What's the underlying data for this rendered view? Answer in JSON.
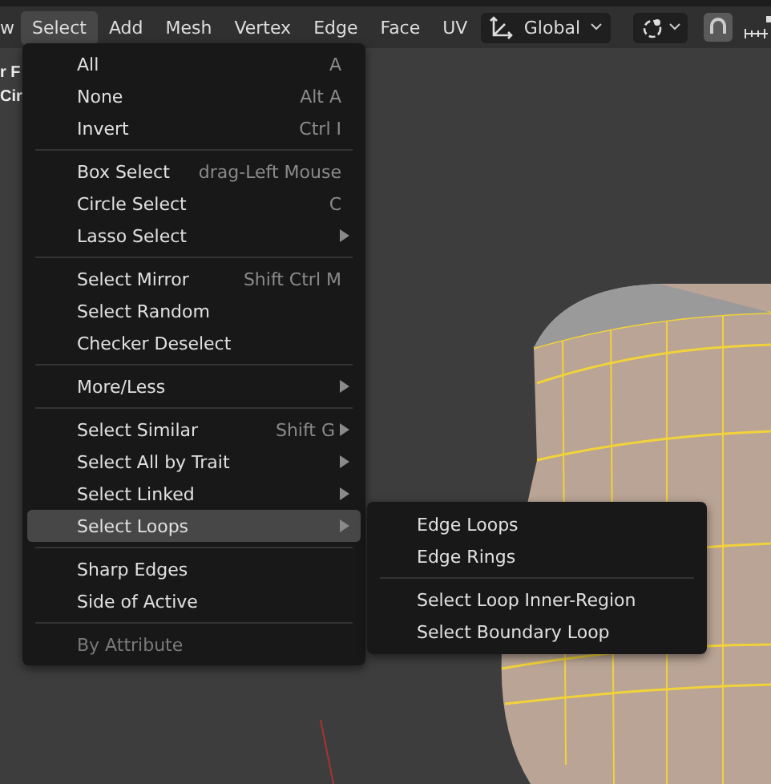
{
  "header": {
    "menus": [
      {
        "label": "w",
        "selected": false
      },
      {
        "label": "Select",
        "selected": true
      },
      {
        "label": "Add",
        "selected": false
      },
      {
        "label": "Mesh",
        "selected": false
      },
      {
        "label": "Vertex",
        "selected": false
      },
      {
        "label": "Edge",
        "selected": false
      },
      {
        "label": "Face",
        "selected": false
      },
      {
        "label": "UV",
        "selected": false
      }
    ],
    "orientation": {
      "label": "Global"
    }
  },
  "side_labels": [
    "r F",
    "Cir"
  ],
  "menu": {
    "items": [
      {
        "kind": "item",
        "label": "All",
        "shortcut": "A",
        "submenu": false,
        "disabled": false,
        "selected": false
      },
      {
        "kind": "item",
        "label": "None",
        "shortcut": "Alt A",
        "submenu": false,
        "disabled": false,
        "selected": false
      },
      {
        "kind": "item",
        "label": "Invert",
        "shortcut": "Ctrl I",
        "submenu": false,
        "disabled": false,
        "selected": false
      },
      {
        "kind": "separator"
      },
      {
        "kind": "item",
        "label": "Box Select",
        "shortcut": "drag-Left Mouse",
        "submenu": false,
        "disabled": false,
        "selected": false
      },
      {
        "kind": "item",
        "label": "Circle Select",
        "shortcut": "C",
        "submenu": false,
        "disabled": false,
        "selected": false
      },
      {
        "kind": "item",
        "label": "Lasso Select",
        "submenu": true,
        "disabled": false,
        "selected": false
      },
      {
        "kind": "separator"
      },
      {
        "kind": "item",
        "label": "Select Mirror",
        "shortcut": "Shift Ctrl M",
        "submenu": false,
        "disabled": false,
        "selected": false
      },
      {
        "kind": "item",
        "label": "Select Random",
        "submenu": false,
        "disabled": false,
        "selected": false
      },
      {
        "kind": "item",
        "label": "Checker Deselect",
        "submenu": false,
        "disabled": false,
        "selected": false
      },
      {
        "kind": "separator"
      },
      {
        "kind": "item",
        "label": "More/Less",
        "submenu": true,
        "disabled": false,
        "selected": false
      },
      {
        "kind": "separator"
      },
      {
        "kind": "item",
        "label": "Select Similar",
        "shortcut": "Shift G",
        "submenu": true,
        "disabled": false,
        "selected": false
      },
      {
        "kind": "item",
        "label": "Select All by Trait",
        "submenu": true,
        "disabled": false,
        "selected": false
      },
      {
        "kind": "item",
        "label": "Select Linked",
        "submenu": true,
        "disabled": false,
        "selected": false
      },
      {
        "kind": "item",
        "label": "Select Loops",
        "submenu": true,
        "disabled": false,
        "selected": true
      },
      {
        "kind": "separator"
      },
      {
        "kind": "item",
        "label": "Sharp Edges",
        "submenu": false,
        "disabled": false,
        "selected": false
      },
      {
        "kind": "item",
        "label": "Side of Active",
        "submenu": false,
        "disabled": false,
        "selected": false
      },
      {
        "kind": "separator"
      },
      {
        "kind": "item",
        "label": "By Attribute",
        "submenu": false,
        "disabled": true,
        "selected": false
      }
    ]
  },
  "submenu": {
    "items": [
      {
        "kind": "item",
        "label": "Edge Loops"
      },
      {
        "kind": "item",
        "label": "Edge Rings"
      },
      {
        "kind": "separator"
      },
      {
        "kind": "item",
        "label": "Select Loop Inner-Region"
      },
      {
        "kind": "item",
        "label": "Select Boundary Loop"
      }
    ]
  }
}
